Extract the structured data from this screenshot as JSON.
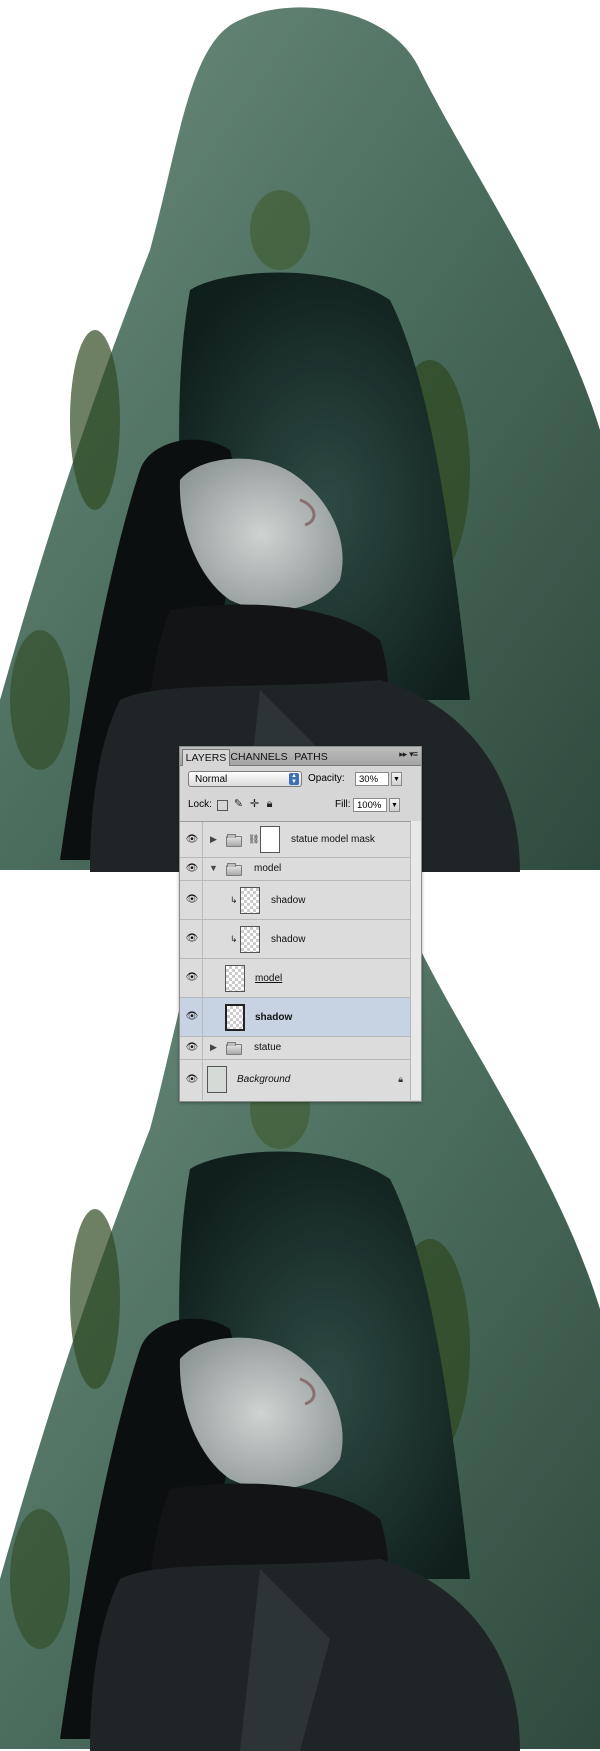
{
  "panel": {
    "tabs": [
      {
        "label": "LAYERS",
        "active": true
      },
      {
        "label": "CHANNELS",
        "active": false
      },
      {
        "label": "PATHS",
        "active": false
      }
    ],
    "menu_icon": "panel-menu-icon",
    "blend_mode": "Normal",
    "opacity_label": "Opacity:",
    "opacity_value": "30%",
    "lock_label": "Lock:",
    "fill_label": "Fill:",
    "fill_value": "100%",
    "lock_icons": [
      "lock-transparency-icon",
      "lock-pixels-icon",
      "lock-position-icon",
      "lock-all-icon"
    ]
  },
  "layers": [
    {
      "name": "statue model mask",
      "type": "group",
      "expanded": false,
      "has_mask": true,
      "visible": true
    },
    {
      "name": "model",
      "type": "group",
      "expanded": true,
      "visible": true
    },
    {
      "name": "shadow",
      "type": "layer",
      "clipped": true,
      "indent": 1,
      "visible": true
    },
    {
      "name": "shadow",
      "type": "layer",
      "clipped": true,
      "indent": 1,
      "visible": true
    },
    {
      "name": "model",
      "type": "layer",
      "style": "underline",
      "indent": 1,
      "visible": true
    },
    {
      "name": "shadow",
      "type": "layer",
      "style": "bold",
      "selected": true,
      "indent": 1,
      "visible": true
    },
    {
      "name": "statue",
      "type": "group",
      "expanded": false,
      "visible": true
    },
    {
      "name": "Background",
      "type": "background",
      "style": "italic",
      "locked": true,
      "visible": true
    }
  ],
  "colors": {
    "selected_row": "#c7d3e2",
    "panel_bg": "#d6d6d6",
    "statue_green": "#4a6e5c",
    "moss": "#2f4a22"
  }
}
